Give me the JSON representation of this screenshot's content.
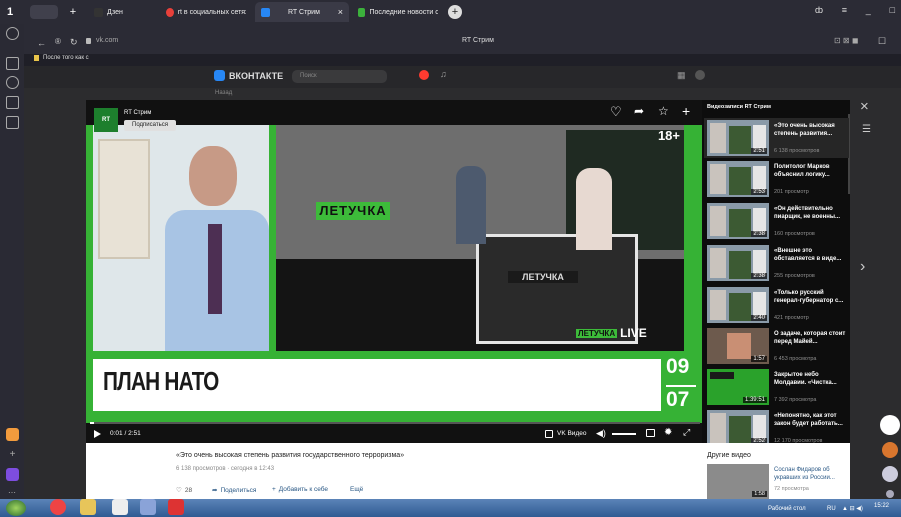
{
  "browser": {
    "tabs": [
      {
        "label": "Дзен"
      },
      {
        "label": "rt в социальных сетях —"
      },
      {
        "label": "RT Стрим"
      },
      {
        "label": "Последние новости о сос"
      }
    ],
    "url": "vk.com",
    "page_title": "RT Стрим",
    "bookmark": "После того как с"
  },
  "vk": {
    "logo": "ВКОНТАКТЕ",
    "search_placeholder": "Поиск",
    "back_label": "Назад"
  },
  "player": {
    "channel": "RT Стрим",
    "subscribe": "Подписаться",
    "age": "18+",
    "lower_third": "ПЛАН НАТО",
    "date_day": "09",
    "date_month": "07",
    "studio_sign": "ЛЕТУЧКА",
    "live_text": "LIVE",
    "time": "0:01 / 2:51",
    "progress": 0.006,
    "vk_video": "VK Видео"
  },
  "info": {
    "title": "«Это очень высокая степень развития государственного терроризма»",
    "meta": "6 138 просмотров · сегодня в 12:43",
    "likes": "28",
    "share": "Поделиться",
    "add": "Добавить к себе",
    "more": "Ещё"
  },
  "playlist": {
    "header": "Видеозаписи RT Стрим",
    "items": [
      {
        "title": "«Это очень высокая степень развития...",
        "views": "6 138 просмотров",
        "dur": "2:51"
      },
      {
        "title": "Политолог Марков объяснил логику...",
        "views": "201 просмотр",
        "dur": "2:53"
      },
      {
        "title": "«Он действительно пиарщик, не военны...",
        "views": "160 просмотров",
        "dur": "2:38"
      },
      {
        "title": "«Внешне это обставляется в виде...",
        "views": "255 просмотров",
        "dur": "2:38"
      },
      {
        "title": "«Только русский генерал-губернатор с...",
        "views": "421 просмотр",
        "dur": "2:40"
      },
      {
        "title": "О задаче, которая стоит перед Майей...",
        "views": "6 453 просмотра",
        "dur": "1:57"
      },
      {
        "title": "Закрытое небо Молдавии. «Чистка...",
        "views": "7 392 просмотра",
        "dur": "1:39:51"
      },
      {
        "title": "«Непонятно, как этот закон будет работать...",
        "views": "12 170 просмотров",
        "dur": "2:52"
      }
    ]
  },
  "other": {
    "header": "Другие видео",
    "title": "Сослан Фидаров об укравших из России...",
    "views": "72 просмотра",
    "dur": "1:58"
  },
  "taskbar": {
    "desktop": "Рабочий стол",
    "lang": "RU",
    "clock": "15:22"
  }
}
